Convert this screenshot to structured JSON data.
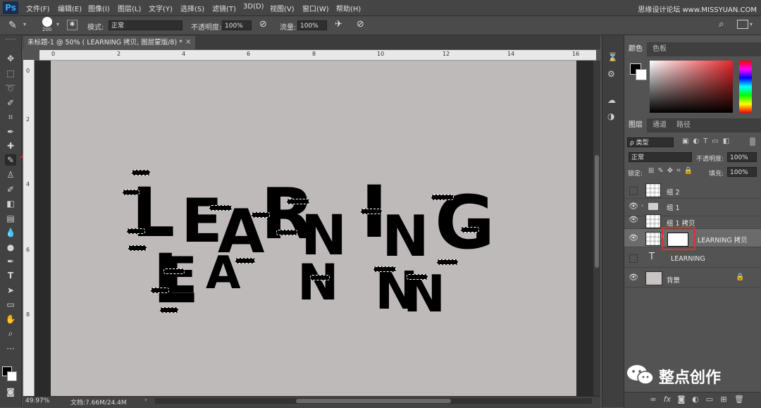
{
  "app": {
    "logo": "Ps"
  },
  "menu": [
    "文件(F)",
    "编辑(E)",
    "图像(I)",
    "图层(L)",
    "文字(Y)",
    "选择(S)",
    "滤镜(T)",
    "3D(D)",
    "视图(V)",
    "窗口(W)",
    "帮助(H)"
  ],
  "watermark": "思缘设计论坛 www.MISSYUAN.COM",
  "options": {
    "brush_size": "200",
    "mode_label": "模式:",
    "mode_value": "正常",
    "opacity_label": "不透明度:",
    "opacity_value": "100%",
    "flow_label": "流量:",
    "flow_value": "100%"
  },
  "document": {
    "tab_title": "未标题-1 @ 50% ( LEARNING 拷贝, 图层蒙版/8) *",
    "close": "×",
    "canvas_text_top": "LEARNING",
    "canvas_text_bottom": "LEARNING"
  },
  "ruler": {
    "top": [
      "0",
      "2",
      "4",
      "6",
      "8",
      "10",
      "12",
      "14",
      "16"
    ],
    "left": [
      "0",
      "2",
      "4",
      "6",
      "8"
    ]
  },
  "status": {
    "zoom": "49.97%",
    "doc_info": "文档:7.66M/24.4M"
  },
  "color_panel": {
    "tabs": [
      "颜色",
      "色板"
    ]
  },
  "layers_panel": {
    "tabs": [
      "图层",
      "通道",
      "路径"
    ],
    "filter_label": "ρ 类型",
    "blend_mode": "正常",
    "opacity_label": "不透明度:",
    "opacity_value": "100%",
    "lock_label": "锁定:",
    "fill_label": "填充:",
    "fill_value": "100%",
    "layers": [
      {
        "name": "组 2"
      },
      {
        "name": "组 1"
      },
      {
        "name": "组 1 拷贝"
      },
      {
        "name": "LEARNING 拷贝"
      },
      {
        "name": "LEARNING"
      },
      {
        "name": "背景"
      }
    ],
    "bottom_icons": [
      "link-icon",
      "fx-icon",
      "mask-icon",
      "adjustment-icon",
      "folder-icon",
      "new-layer-icon",
      "trash-icon"
    ]
  },
  "brand_watermark": "整点创作",
  "colors": {
    "accent_red": "#e03030",
    "canvas": "#bfbaba"
  }
}
